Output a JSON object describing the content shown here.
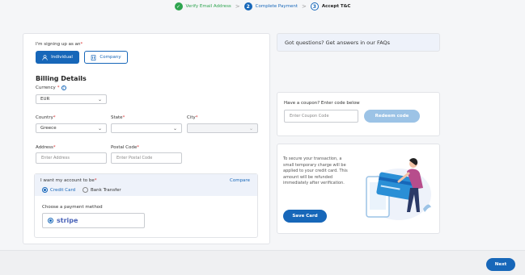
{
  "stepper": {
    "steps": [
      {
        "num": "✓",
        "label": "Verify Email Address"
      },
      {
        "num": "2",
        "label": "Complete Payment"
      },
      {
        "num": "3",
        "label": "Accept T&C"
      }
    ],
    "separator": ">"
  },
  "signup": {
    "label": "I'm signing up as an",
    "required": "*",
    "individual": "Individual",
    "company": "Company"
  },
  "billing": {
    "title": "Billing Details",
    "currency_label": "Currency",
    "currency_value": "EUR",
    "country_label": "Country",
    "country_value": "Greece",
    "state_label": "State",
    "state_value": "",
    "city_label": "City",
    "city_value": "",
    "address_label": "Address",
    "address_placeholder": "Enter Address",
    "postal_label": "Postal Code",
    "postal_placeholder": "Enter Postal Code"
  },
  "payment": {
    "want_label": "I want my account to be",
    "compare": "Compare",
    "credit_card": "Credit Card",
    "bank_transfer": "Bank Transfer",
    "method_label": "Choose a payment method",
    "stripe": "stripe"
  },
  "faq": {
    "text": "Got questions? Get answers in our",
    "link": "FAQs"
  },
  "coupon": {
    "label": "Have a coupon? Enter code below",
    "placeholder": "Enter Coupon Code",
    "button": "Redeem code"
  },
  "secure": {
    "text": "To secure your transaction, a small temporary charge will be applied to your credit card. This amount will be refunded immediately after verification.",
    "button": "Save Card"
  },
  "footer": {
    "next": "Next"
  },
  "colors": {
    "primary": "#1767b9",
    "success": "#2ea44f"
  }
}
